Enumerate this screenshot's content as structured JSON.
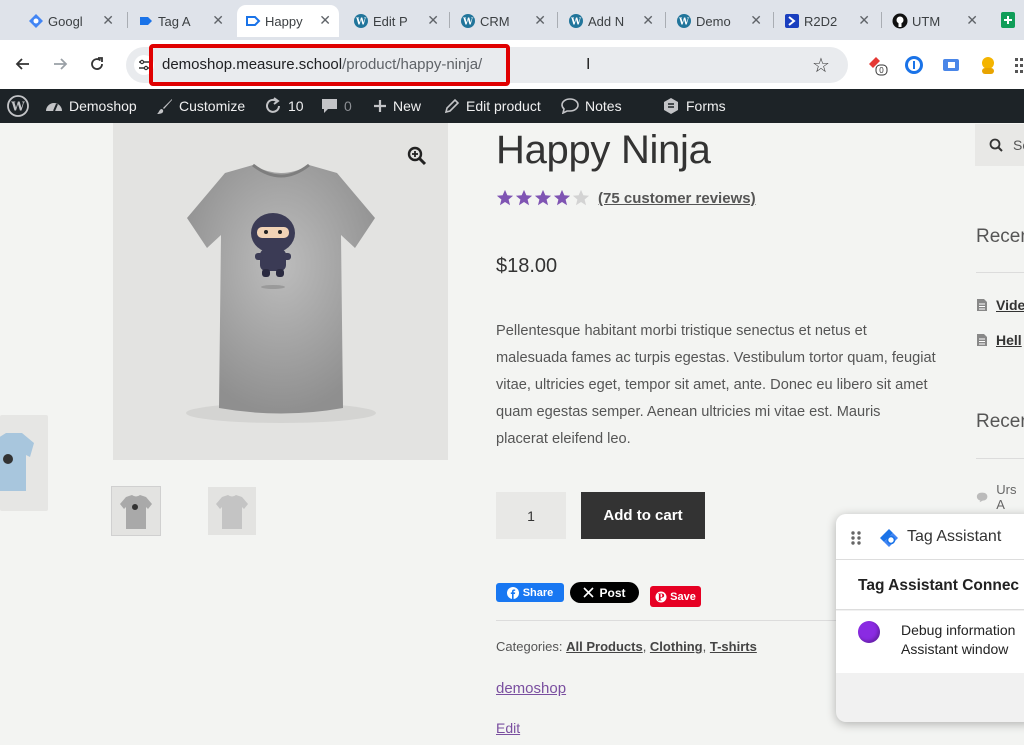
{
  "browser": {
    "tabs": [
      {
        "title": "Googl",
        "icon": "google-tag-manager-icon"
      },
      {
        "title": "Tag A",
        "icon": "tag-assistant-icon"
      },
      {
        "title": "Happy",
        "icon": "tag-icon",
        "active": true
      },
      {
        "title": "Edit P",
        "icon": "wordpress-icon"
      },
      {
        "title": "CRM",
        "icon": "wordpress-icon"
      },
      {
        "title": "Add N",
        "icon": "wordpress-icon"
      },
      {
        "title": "Demo",
        "icon": "wordpress-icon"
      },
      {
        "title": "R2D2",
        "icon": "r2d2-icon"
      },
      {
        "title": "UTM",
        "icon": "github-icon"
      }
    ],
    "address": {
      "domain": "demoshop.measure.school",
      "path": "/product/happy-ninja/"
    },
    "extension_badge": "0"
  },
  "adminbar": {
    "site_name": "Demoshop",
    "customize": "Customize",
    "updates_count": "10",
    "comments_count": "0",
    "new_label": "New",
    "edit_product": "Edit product",
    "notes": "Notes",
    "forms": "Forms"
  },
  "product": {
    "title": "Happy Ninja",
    "rating": 4,
    "rating_max": 5,
    "reviews_link": "(75 customer reviews)",
    "price": "$18.00",
    "description": "Pellentesque habitant morbi tristique senectus et netus et malesuada fames ac turpis egestas. Vestibulum tortor quam, feugiat vitae, ultricies eget, tempor sit amet, ante. Donec eu libero sit amet quam egestas semper. Aenean ultricies mi vitae est. Mauris placerat eleifend leo.",
    "quantity": "1",
    "add_to_cart": "Add to cart",
    "share": {
      "facebook": "Share",
      "x": "Post",
      "pinterest": "Save"
    },
    "categories_label": "Categories:",
    "categories": [
      "All Products",
      "Clothing",
      "T-shirts"
    ],
    "brand": "demoshop",
    "edit": "Edit"
  },
  "sidebar": {
    "search_placeholder": "Se",
    "recent_posts_heading": "Recen",
    "recent_posts": [
      "Vide",
      "Hell"
    ],
    "recent_comments_heading": "Recen",
    "recent_comment": "Urs A"
  },
  "tag_assistant": {
    "title": "Tag Assistant",
    "connected": "Tag Assistant Connec",
    "debug_line1": "Debug information",
    "debug_line2": "Assistant window"
  },
  "colors": {
    "accent_purple": "#7f54b3",
    "url_highlight": "#e00000",
    "admin_bar": "#1d2327",
    "facebook": "#1877f2",
    "pinterest": "#e60023"
  }
}
